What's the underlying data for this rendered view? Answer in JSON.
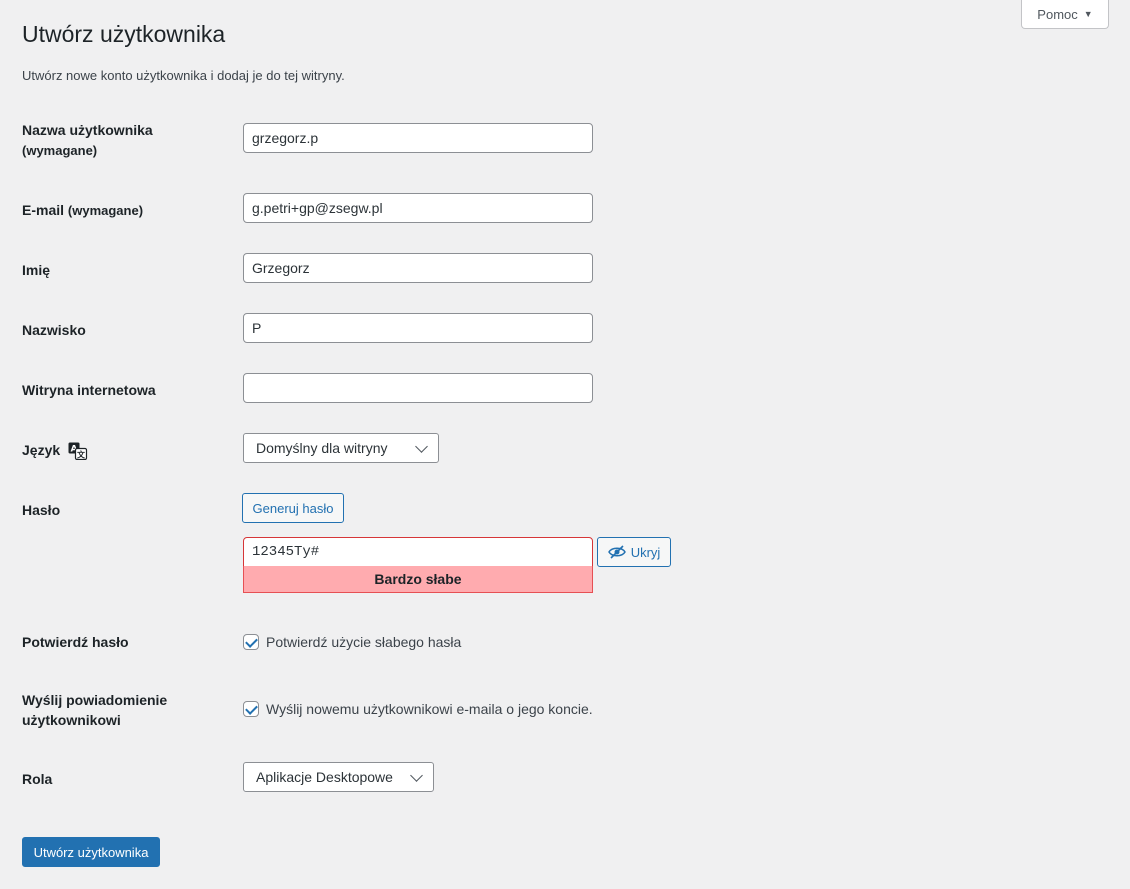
{
  "help_tab": {
    "label": "Pomoc"
  },
  "page": {
    "title": "Utwórz użytkownika",
    "intro": "Utwórz nowe konto użytkownika i dodaj je do tej witryny."
  },
  "fields": {
    "username": {
      "label": "Nazwa użytkownika",
      "required": "(wymagane)",
      "value": "grzegorz.p"
    },
    "email": {
      "label": "E-mail",
      "required": "(wymagane)",
      "value": "g.petri+gp@zsegw.pl"
    },
    "first_name": {
      "label": "Imię",
      "value": "Grzegorz"
    },
    "last_name": {
      "label": "Nazwisko",
      "value": "P"
    },
    "website": {
      "label": "Witryna internetowa",
      "value": ""
    },
    "language": {
      "label": "Język",
      "icon": "translation-icon",
      "selected": "Domyślny dla witryny"
    },
    "password": {
      "label": "Hasło",
      "generate_label": "Generuj hasło",
      "value": "12345Ty#",
      "hide_label": "Ukryj",
      "hide_icon": "eye-slash-icon",
      "strength": "Bardzo słabe"
    },
    "confirm_password": {
      "label": "Potwierdź hasło",
      "checkbox_label": "Potwierdź użycie słabego hasła",
      "checked": true
    },
    "send_notification": {
      "label": "Wyślij powiadomienie użytkownikowi",
      "checkbox_label": "Wyślij nowemu użytkownikowi e-maila o jego koncie.",
      "checked": true
    },
    "role": {
      "label": "Rola",
      "selected": "Aplikacje Desktopowe"
    }
  },
  "submit": {
    "label": "Utwórz użytkownika"
  },
  "colors": {
    "primary": "#2271b1",
    "background": "#f0f0f1",
    "weak_strength_bg": "#ffabaf",
    "error_border": "#d63638"
  }
}
